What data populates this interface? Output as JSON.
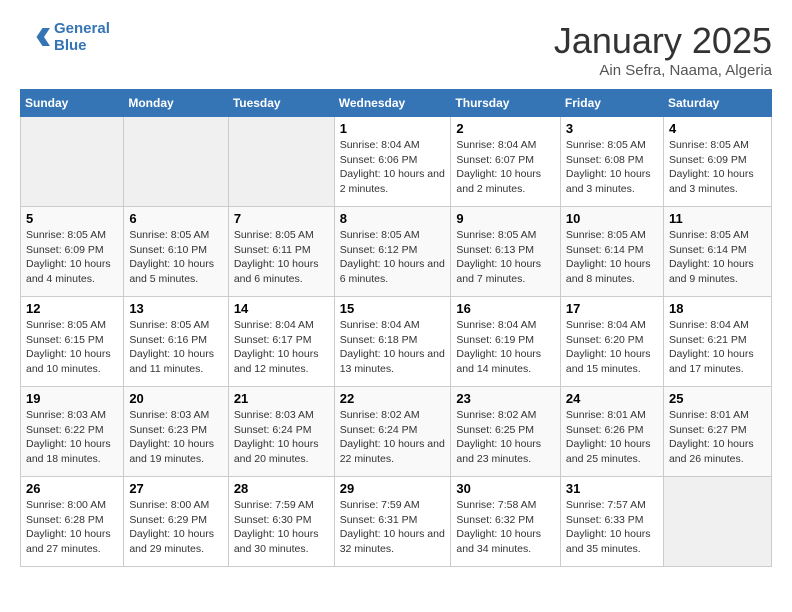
{
  "header": {
    "logo_line1": "General",
    "logo_line2": "Blue",
    "month_title": "January 2025",
    "location": "Ain Sefra, Naama, Algeria"
  },
  "weekdays": [
    "Sunday",
    "Monday",
    "Tuesday",
    "Wednesday",
    "Thursday",
    "Friday",
    "Saturday"
  ],
  "weeks": [
    [
      {
        "day": "",
        "sunrise": "",
        "sunset": "",
        "daylight": "",
        "empty": true
      },
      {
        "day": "",
        "sunrise": "",
        "sunset": "",
        "daylight": "",
        "empty": true
      },
      {
        "day": "",
        "sunrise": "",
        "sunset": "",
        "daylight": "",
        "empty": true
      },
      {
        "day": "1",
        "sunrise": "Sunrise: 8:04 AM",
        "sunset": "Sunset: 6:06 PM",
        "daylight": "Daylight: 10 hours and 2 minutes."
      },
      {
        "day": "2",
        "sunrise": "Sunrise: 8:04 AM",
        "sunset": "Sunset: 6:07 PM",
        "daylight": "Daylight: 10 hours and 2 minutes."
      },
      {
        "day": "3",
        "sunrise": "Sunrise: 8:05 AM",
        "sunset": "Sunset: 6:08 PM",
        "daylight": "Daylight: 10 hours and 3 minutes."
      },
      {
        "day": "4",
        "sunrise": "Sunrise: 8:05 AM",
        "sunset": "Sunset: 6:09 PM",
        "daylight": "Daylight: 10 hours and 3 minutes."
      }
    ],
    [
      {
        "day": "5",
        "sunrise": "Sunrise: 8:05 AM",
        "sunset": "Sunset: 6:09 PM",
        "daylight": "Daylight: 10 hours and 4 minutes."
      },
      {
        "day": "6",
        "sunrise": "Sunrise: 8:05 AM",
        "sunset": "Sunset: 6:10 PM",
        "daylight": "Daylight: 10 hours and 5 minutes."
      },
      {
        "day": "7",
        "sunrise": "Sunrise: 8:05 AM",
        "sunset": "Sunset: 6:11 PM",
        "daylight": "Daylight: 10 hours and 6 minutes."
      },
      {
        "day": "8",
        "sunrise": "Sunrise: 8:05 AM",
        "sunset": "Sunset: 6:12 PM",
        "daylight": "Daylight: 10 hours and 6 minutes."
      },
      {
        "day": "9",
        "sunrise": "Sunrise: 8:05 AM",
        "sunset": "Sunset: 6:13 PM",
        "daylight": "Daylight: 10 hours and 7 minutes."
      },
      {
        "day": "10",
        "sunrise": "Sunrise: 8:05 AM",
        "sunset": "Sunset: 6:14 PM",
        "daylight": "Daylight: 10 hours and 8 minutes."
      },
      {
        "day": "11",
        "sunrise": "Sunrise: 8:05 AM",
        "sunset": "Sunset: 6:14 PM",
        "daylight": "Daylight: 10 hours and 9 minutes."
      }
    ],
    [
      {
        "day": "12",
        "sunrise": "Sunrise: 8:05 AM",
        "sunset": "Sunset: 6:15 PM",
        "daylight": "Daylight: 10 hours and 10 minutes."
      },
      {
        "day": "13",
        "sunrise": "Sunrise: 8:05 AM",
        "sunset": "Sunset: 6:16 PM",
        "daylight": "Daylight: 10 hours and 11 minutes."
      },
      {
        "day": "14",
        "sunrise": "Sunrise: 8:04 AM",
        "sunset": "Sunset: 6:17 PM",
        "daylight": "Daylight: 10 hours and 12 minutes."
      },
      {
        "day": "15",
        "sunrise": "Sunrise: 8:04 AM",
        "sunset": "Sunset: 6:18 PM",
        "daylight": "Daylight: 10 hours and 13 minutes."
      },
      {
        "day": "16",
        "sunrise": "Sunrise: 8:04 AM",
        "sunset": "Sunset: 6:19 PM",
        "daylight": "Daylight: 10 hours and 14 minutes."
      },
      {
        "day": "17",
        "sunrise": "Sunrise: 8:04 AM",
        "sunset": "Sunset: 6:20 PM",
        "daylight": "Daylight: 10 hours and 15 minutes."
      },
      {
        "day": "18",
        "sunrise": "Sunrise: 8:04 AM",
        "sunset": "Sunset: 6:21 PM",
        "daylight": "Daylight: 10 hours and 17 minutes."
      }
    ],
    [
      {
        "day": "19",
        "sunrise": "Sunrise: 8:03 AM",
        "sunset": "Sunset: 6:22 PM",
        "daylight": "Daylight: 10 hours and 18 minutes."
      },
      {
        "day": "20",
        "sunrise": "Sunrise: 8:03 AM",
        "sunset": "Sunset: 6:23 PM",
        "daylight": "Daylight: 10 hours and 19 minutes."
      },
      {
        "day": "21",
        "sunrise": "Sunrise: 8:03 AM",
        "sunset": "Sunset: 6:24 PM",
        "daylight": "Daylight: 10 hours and 20 minutes."
      },
      {
        "day": "22",
        "sunrise": "Sunrise: 8:02 AM",
        "sunset": "Sunset: 6:24 PM",
        "daylight": "Daylight: 10 hours and 22 minutes."
      },
      {
        "day": "23",
        "sunrise": "Sunrise: 8:02 AM",
        "sunset": "Sunset: 6:25 PM",
        "daylight": "Daylight: 10 hours and 23 minutes."
      },
      {
        "day": "24",
        "sunrise": "Sunrise: 8:01 AM",
        "sunset": "Sunset: 6:26 PM",
        "daylight": "Daylight: 10 hours and 25 minutes."
      },
      {
        "day": "25",
        "sunrise": "Sunrise: 8:01 AM",
        "sunset": "Sunset: 6:27 PM",
        "daylight": "Daylight: 10 hours and 26 minutes."
      }
    ],
    [
      {
        "day": "26",
        "sunrise": "Sunrise: 8:00 AM",
        "sunset": "Sunset: 6:28 PM",
        "daylight": "Daylight: 10 hours and 27 minutes."
      },
      {
        "day": "27",
        "sunrise": "Sunrise: 8:00 AM",
        "sunset": "Sunset: 6:29 PM",
        "daylight": "Daylight: 10 hours and 29 minutes."
      },
      {
        "day": "28",
        "sunrise": "Sunrise: 7:59 AM",
        "sunset": "Sunset: 6:30 PM",
        "daylight": "Daylight: 10 hours and 30 minutes."
      },
      {
        "day": "29",
        "sunrise": "Sunrise: 7:59 AM",
        "sunset": "Sunset: 6:31 PM",
        "daylight": "Daylight: 10 hours and 32 minutes."
      },
      {
        "day": "30",
        "sunrise": "Sunrise: 7:58 AM",
        "sunset": "Sunset: 6:32 PM",
        "daylight": "Daylight: 10 hours and 34 minutes."
      },
      {
        "day": "31",
        "sunrise": "Sunrise: 7:57 AM",
        "sunset": "Sunset: 6:33 PM",
        "daylight": "Daylight: 10 hours and 35 minutes."
      },
      {
        "day": "",
        "sunrise": "",
        "sunset": "",
        "daylight": "",
        "empty": true
      }
    ]
  ]
}
